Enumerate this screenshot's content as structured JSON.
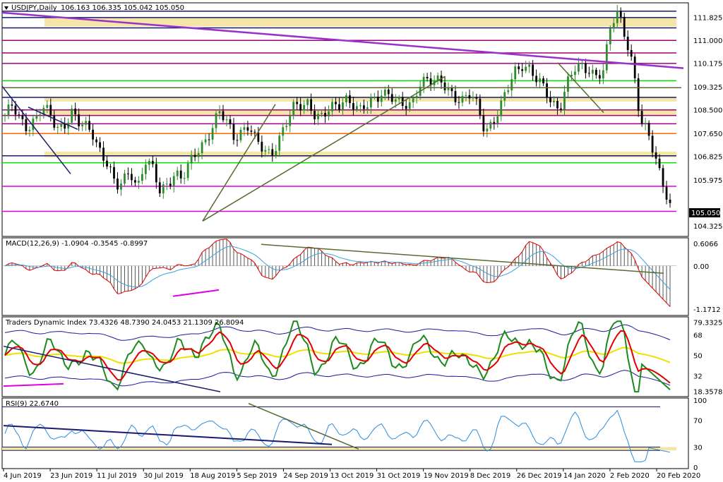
{
  "panels": {
    "price": {
      "label": "USDJPY,Daily",
      "ohlc": "106.163 106.335 105.042 105.050",
      "last_price": "105.050"
    },
    "macd": {
      "label": "MACD(12,26,9) -1.0904 -0.3545 -0.8997"
    },
    "tdi": {
      "label": "Traders Dynamic Index 73.4326 48.7390 24.0453 21.1309 26.8094"
    },
    "rsi": {
      "label": "RSI(9) 22.6740"
    }
  },
  "chart_data": [
    {
      "type": "candlestick",
      "panel": "price",
      "title": "USDJPY,Daily",
      "ylim": [
        104.0,
        112.3
      ],
      "y_ticks": [
        "111.825",
        "111.000",
        "110.175",
        "109.325",
        "108.500",
        "107.650",
        "106.825",
        "105.975",
        "105.050",
        "104.325"
      ],
      "x_ticks": [
        "4 Jun 2019",
        "23 Jun 2019",
        "11 Jul 2019",
        "30 Jul 2019",
        "18 Aug 2019",
        "5 Sep 2019",
        "24 Sep 2019",
        "13 Oct 2019",
        "31 Oct 2019",
        "19 Nov 2019",
        "8 Dec 2019",
        "26 Dec 2019",
        "14 Jan 2020",
        "2 Feb 2020",
        "20 Feb 2020"
      ],
      "close_anchors": [
        108.3,
        108.6,
        108.1,
        107.9,
        108.2,
        108.6,
        108.3,
        107.8,
        108.0,
        108.5,
        108.0,
        107.8,
        107.6,
        107.0,
        106.6,
        105.6,
        105.9,
        106.3,
        105.8,
        106.7,
        106.3,
        105.5,
        105.9,
        106.3,
        106.0,
        106.5,
        107.0,
        107.4,
        107.9,
        108.4,
        108.0,
        107.5,
        107.8,
        108.0,
        107.3,
        107.0,
        106.9,
        107.5,
        108.0,
        108.5,
        108.6,
        108.8,
        108.4,
        108.2,
        108.5,
        108.6,
        109.0,
        108.8,
        108.4,
        108.6,
        108.9,
        109.2,
        109.1,
        108.7,
        108.6,
        108.7,
        109.5,
        109.6,
        109.4,
        109.5,
        109.3,
        109.0,
        108.8,
        109.0,
        108.6,
        107.8,
        108.1,
        108.5,
        109.2,
        109.9,
        110.2,
        110.0,
        109.5,
        109.2,
        108.8,
        108.6,
        109.4,
        109.9,
        110.0,
        110.0,
        109.8,
        109.9,
        111.5,
        112.0,
        111.2,
        110.1,
        108.0,
        107.6,
        106.8,
        106.0,
        105.05
      ],
      "horizontal_levels": [
        112.05,
        111.82,
        111.45,
        111.0,
        110.55,
        110.17,
        109.55,
        109.3,
        108.95,
        108.5,
        108.3,
        108.0,
        107.65,
        106.85,
        106.6,
        105.75,
        104.85
      ],
      "zones": [
        [
          111.5,
          111.82
        ],
        [
          108.8,
          108.95
        ],
        [
          108.3,
          108.5
        ],
        [
          106.8,
          107.0
        ]
      ]
    },
    {
      "type": "macd",
      "panel": "macd",
      "title": "MACD(12,26,9)",
      "values": {
        "macd": -1.0904,
        "signal": -0.3545,
        "histogram": -0.8997
      },
      "y_ticks": [
        "0.6066",
        "0.00",
        "-1.1712"
      ]
    },
    {
      "type": "line",
      "panel": "tdi",
      "title": "Traders Dynamic Index",
      "values": [
        73.4326,
        48.739,
        24.0453,
        21.1309,
        26.8094
      ],
      "y_ticks": [
        "79.3325",
        "68",
        "50",
        "32",
        "18.3578"
      ],
      "ylim": [
        15,
        82
      ]
    },
    {
      "type": "line",
      "panel": "rsi",
      "title": "RSI(9)",
      "values": [
        22.674
      ],
      "y_ticks": [
        "100",
        "70",
        "30",
        "0"
      ],
      "levels": [
        90,
        30,
        25
      ],
      "ylim": [
        0,
        100
      ]
    }
  ],
  "colors": {
    "bull": "#2e8b2e",
    "bear": "#000000",
    "trend_olive": "#556b2f",
    "navy": "#1a1a6e",
    "magenta": "#e000e0",
    "green": "#00e000",
    "orange": "#ff6a00",
    "purple": "#9932cc",
    "zone": "#f5e6a8",
    "tdi_red": "#e00000",
    "tdi_green": "#1c8a1c",
    "tdi_yellow": "#f0e000",
    "tdi_band": "#1a1aa0",
    "rsi_line": "#2a8ce0",
    "macd_signal": "#3aa0e0",
    "macd_line": "#e00000"
  }
}
